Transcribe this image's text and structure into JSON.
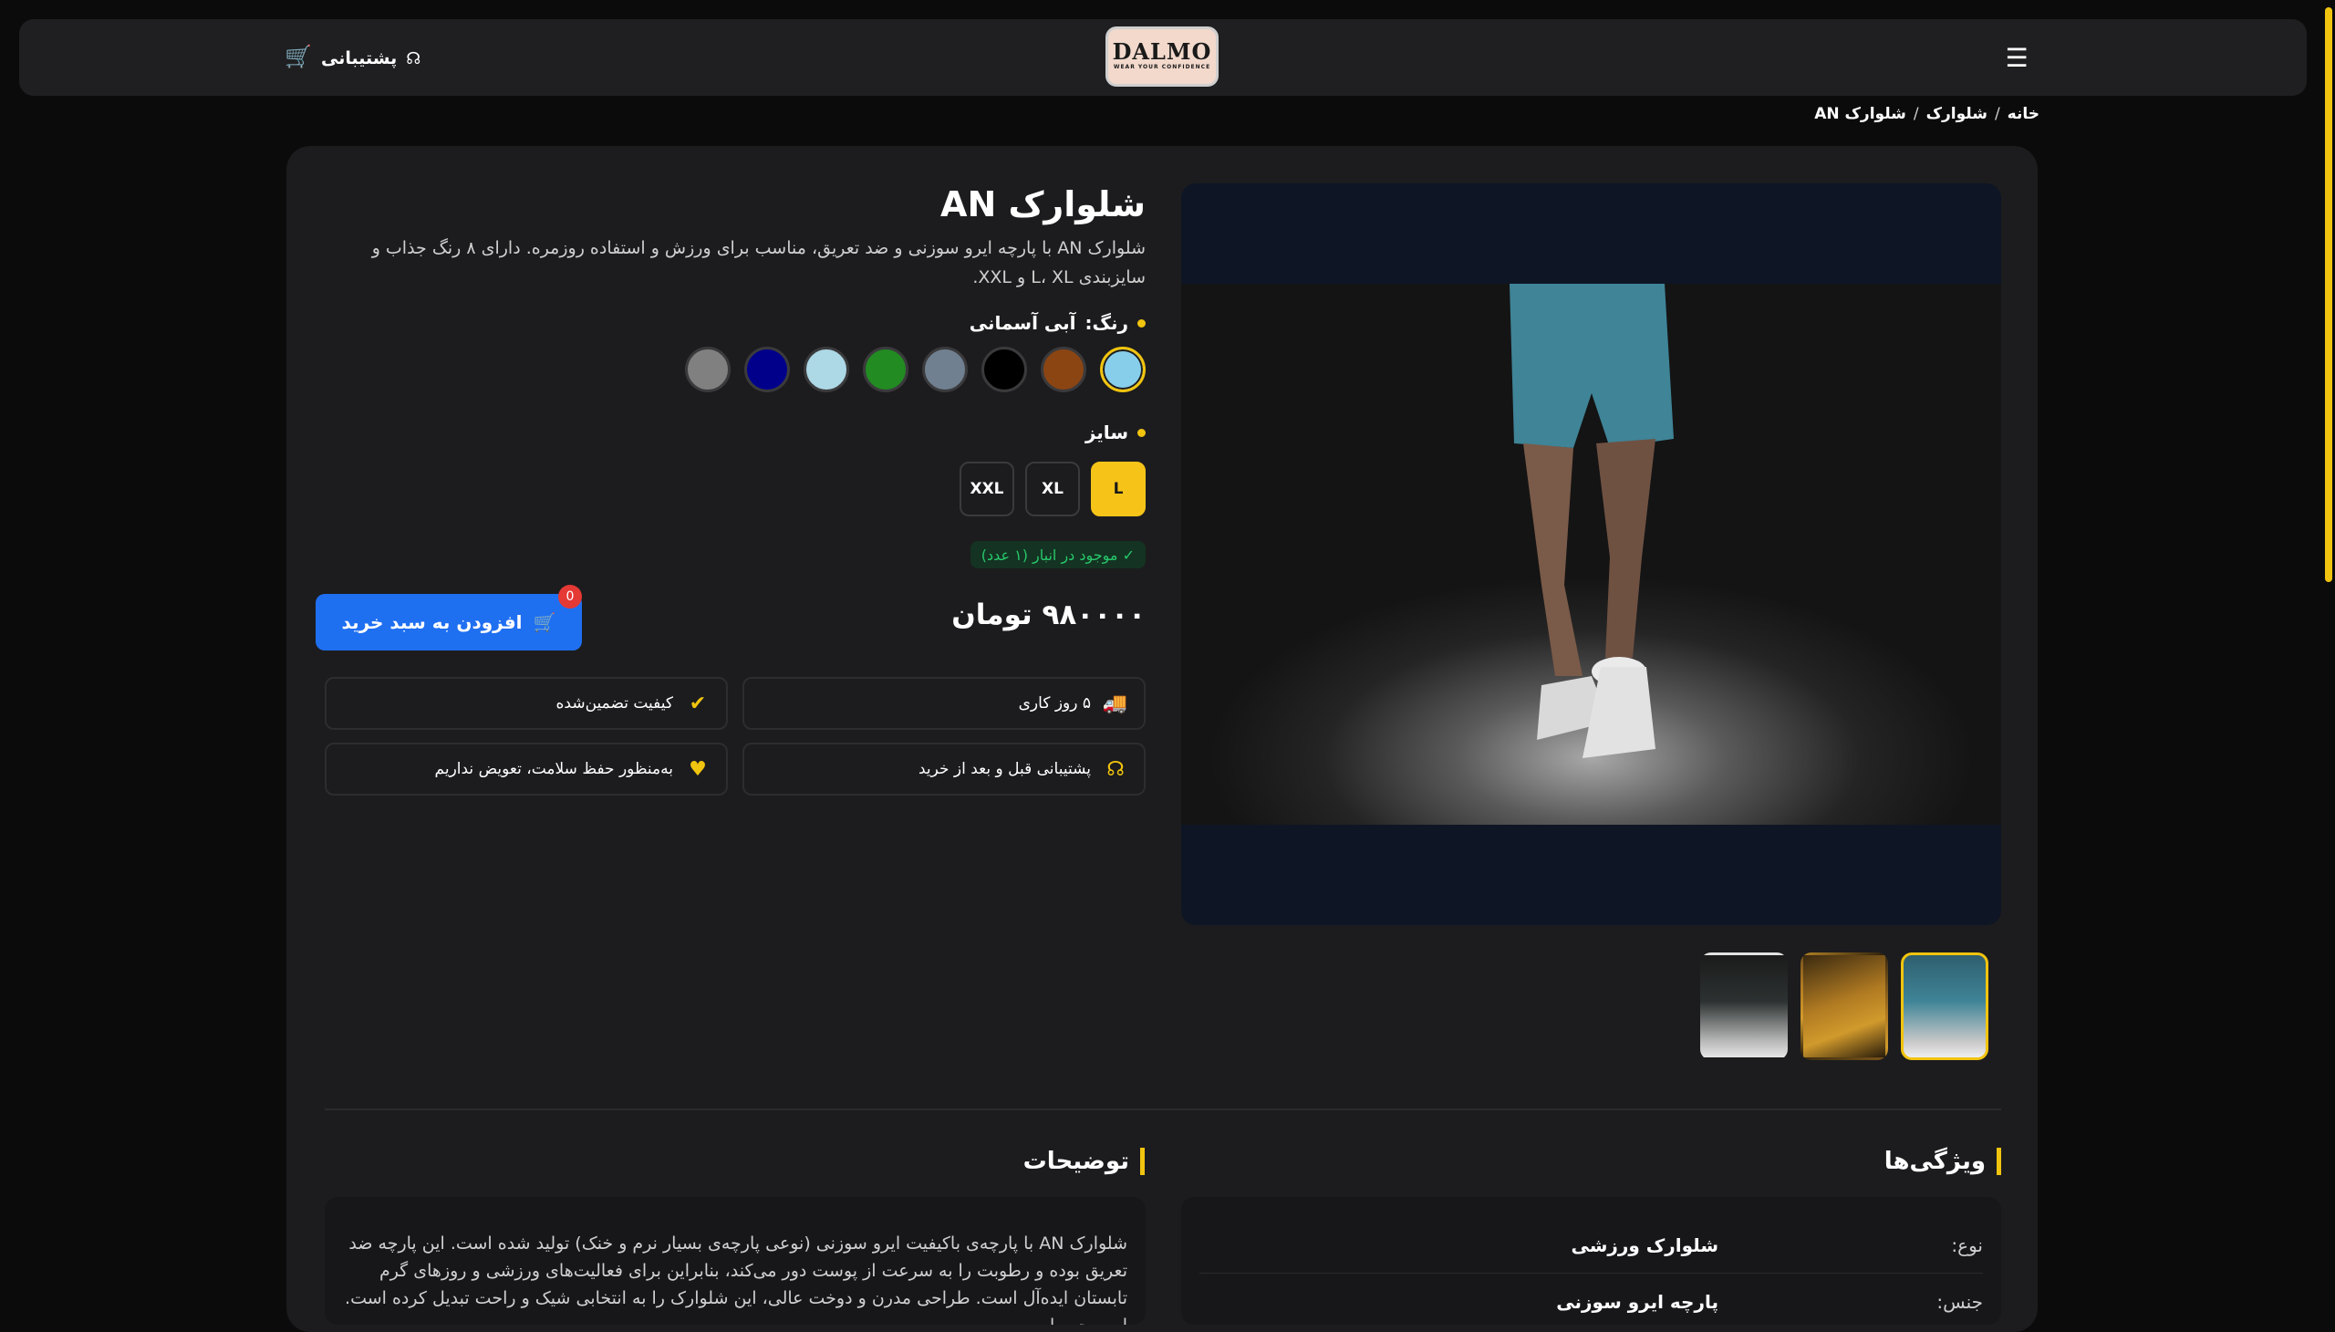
{
  "header": {
    "logo_name": "DALMO",
    "logo_tagline": "WEAR YOUR CONFIDENCE",
    "support_label": "پشتیبانی",
    "menu_icon": "hamburger-icon",
    "cart_icon": "cart-icon",
    "support_icon": "headset-icon"
  },
  "breadcrumb": {
    "home": "خانه",
    "category": "شلوارک",
    "current": "شلوارک AN",
    "separator": "/"
  },
  "product": {
    "title": "شلوارک AN",
    "description": "شلوارک AN با پارچه ایرو سوزنی و ضد تعریق، مناسب برای ورزش و استفاده روزمره. دارای ۸ رنگ جذاب و سایزبندی L، XL و XXL.",
    "color_label": "رنگ:",
    "selected_color": "آبی آسمانی",
    "colors": [
      "#87ceeb",
      "#8b4513",
      "#000000",
      "#708090",
      "#228b22",
      "#add8e6",
      "#00008b",
      "#808080"
    ],
    "size_label": "سایز",
    "sizes": [
      "L",
      "XL",
      "XXL"
    ],
    "selected_size": "L",
    "stock_text": "✓ موجود در انبار (۱ عدد)",
    "price": "۹۸۰۰۰۰ تومان",
    "add_to_cart": "افزودن به سبد خرید",
    "cart_count": "0"
  },
  "features": [
    {
      "icon": "truck-icon",
      "glyph": "🚚",
      "label": "۵ روز کاری"
    },
    {
      "icon": "check-badge-icon",
      "glyph": "✔",
      "label": "کیفیت تضمین‌شده"
    },
    {
      "icon": "headset-icon",
      "glyph": "☊",
      "label": "پشتیبانی قبل و بعد از خرید"
    },
    {
      "icon": "heart-pulse-icon",
      "glyph": "♥",
      "label": "به‌منظور حفظ سلامت، تعویض نداریم"
    }
  ],
  "sections": {
    "features_title": "ویژگی‌ها",
    "description_title": "توضیحات",
    "long_description": "شلوارک AN با پارچه‌ی باکیفیت ایرو سوزنی (نوعی پارچه‌ی بسیار نرم و خنک) تولید شده است. این پارچه ضد تعریق بوده و رطوبت را به سرعت از پوست دور می‌کند، بنابراین برای فعالیت‌های ورزشی و روزهای گرم تابستان ایده‌آل است. طراحی مدرن و دوخت عالی، این شلوارک را به انتخابی شیک و راحت تبدیل کرده است. این محصول",
    "specs": [
      {
        "key": "نوع:",
        "value": "شلوارک ورزشی"
      },
      {
        "key": "جنس:",
        "value": "پارچه ایرو سوزنی"
      }
    ]
  },
  "accent_color": "#f1c40f",
  "primary_button_color": "#1f6ff1"
}
